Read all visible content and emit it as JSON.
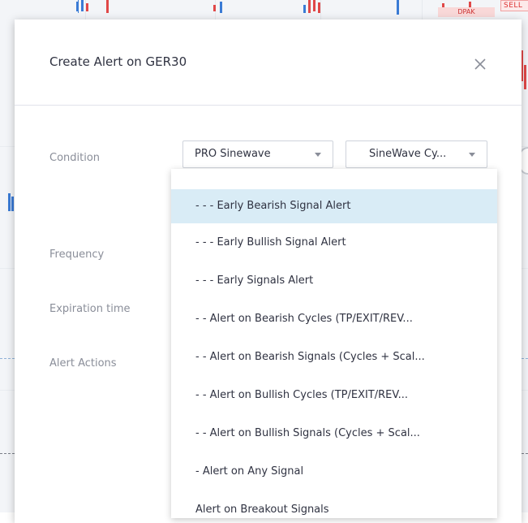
{
  "dialog": {
    "title": "Create Alert on GER30"
  },
  "background_tags": {
    "sell": "SELL",
    "dpak": "DPAK"
  },
  "labels": {
    "condition": "Condition",
    "frequency": "Frequency",
    "expiration": "Expiration time",
    "actions": "Alert Actions"
  },
  "condition": {
    "indicator": "PRO Sinewave",
    "plot": "SineWave Cy..."
  },
  "dropdown": {
    "selected_index": 0,
    "items": [
      "- - - Early Bearish Signal Alert",
      "- - - Early Bullish Signal Alert",
      "- - - Early Signals Alert",
      "- - Alert on Bearish Cycles (TP/EXIT/REV...",
      "- - Alert on Bearish Signals (Cycles + Scal...",
      "- - Alert on Bullish Cycles (TP/EXIT/REV...",
      "- - Alert on Bullish Signals (Cycles + Scal...",
      "- Alert on Any Signal",
      "Alert on Breakout Signals"
    ]
  },
  "colors": {
    "selected_bg": "#d9ecf6",
    "text": "#2f3241",
    "muted": "#8a8e99",
    "bear": "#e04848",
    "bull": "#3a7bd5"
  }
}
